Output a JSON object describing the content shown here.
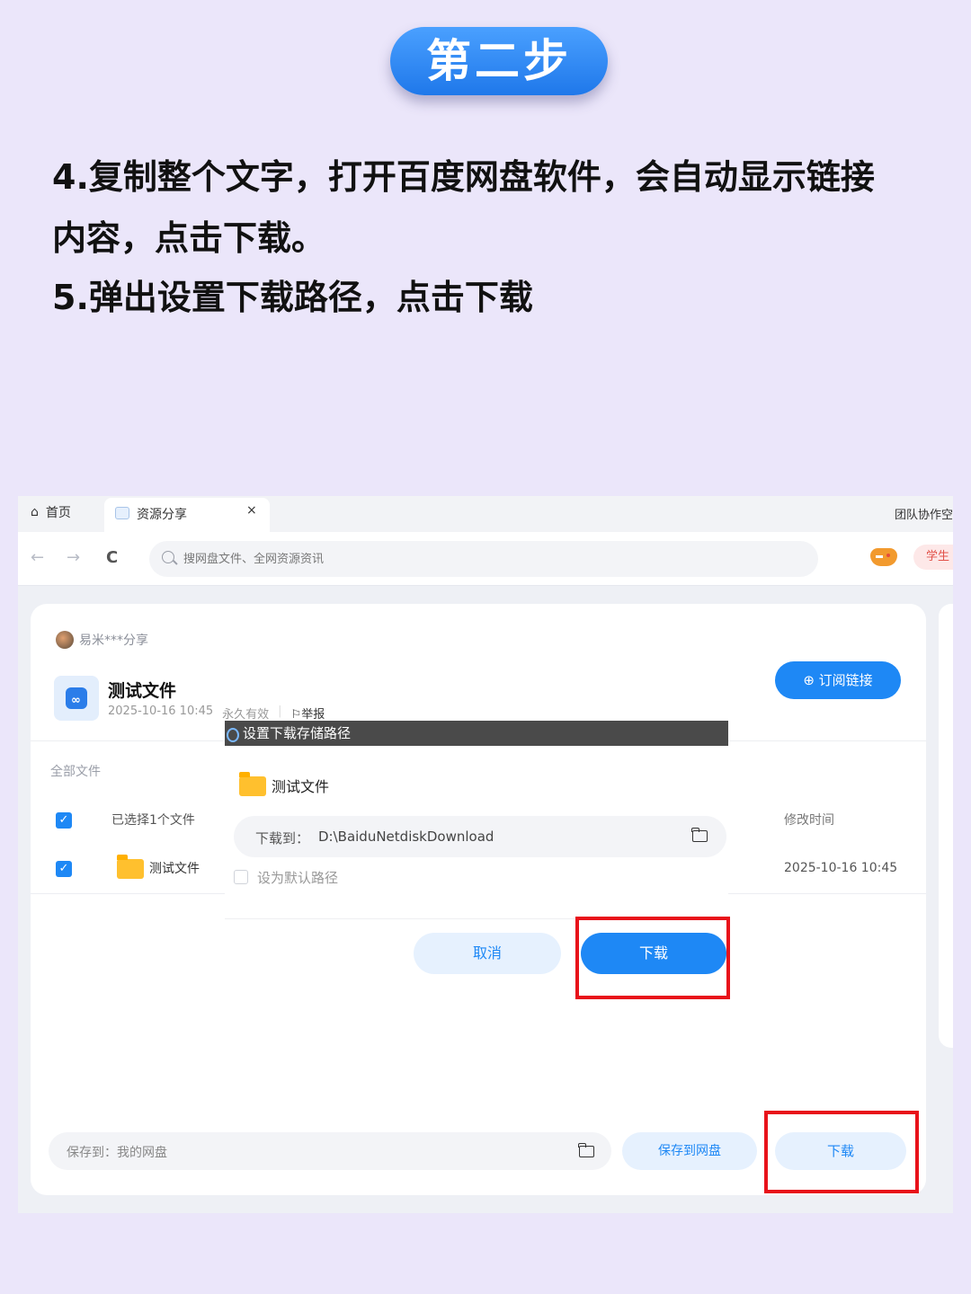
{
  "step": {
    "label": "第二步"
  },
  "instructions": {
    "line1": "4.复制整个文字，打开百度网盘软件，会自动显示链接",
    "line2": "内容，点击下载。",
    "line3": "5.弹出设置下载路径，点击下载"
  },
  "tabs": {
    "home": "首页",
    "resource_share": "资源分享",
    "close": "×",
    "team": "团队协作空"
  },
  "nav": {
    "back": "←",
    "forward": "→",
    "refresh": "C",
    "search_placeholder": "搜网盘文件、全网资源资讯",
    "student": "学生"
  },
  "share": {
    "sharer": "易米***分享",
    "file_title": "测试文件",
    "date": "2025-10-16 10:45",
    "validity": "永久有效",
    "report": "举报",
    "subscribe": "订阅链接",
    "all_files": "全部文件",
    "selected": "已选择1个文件",
    "mod_time_header": "修改时间",
    "rows": [
      {
        "name": "测试文件",
        "time": "2025-10-16 10:45",
        "checked": "✓"
      }
    ],
    "select_all_check": "✓",
    "save_to": "保存到：我的网盘",
    "save_to_net": "保存到网盘",
    "download": "下载"
  },
  "dialog": {
    "title": "设置下载存储路径",
    "folder_name": "测试文件",
    "path_label": "下载到：",
    "path_value": "D:\\BaiduNetdiskDownload",
    "default_path": "设为默认路径",
    "cancel": "取消",
    "download": "下载"
  },
  "colors": {
    "accent": "#1e88f5",
    "highlight": "#e8121a",
    "background": "#ebe6fa"
  }
}
